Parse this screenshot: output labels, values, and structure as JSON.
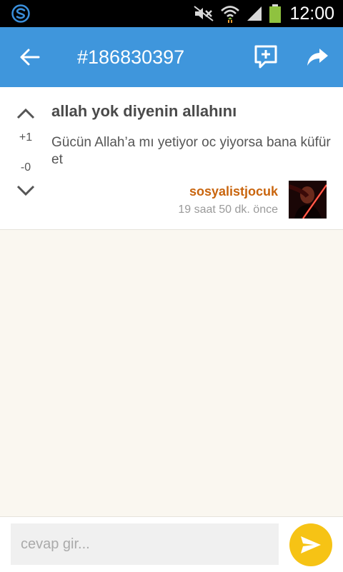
{
  "status_bar": {
    "time": "12:00",
    "icons": [
      "app-logo-icon",
      "mute-icon",
      "wifi-icon",
      "signal-icon",
      "battery-icon"
    ]
  },
  "header": {
    "title": "#186830397",
    "back_icon": "arrow-left-icon",
    "add_comment_icon": "add-comment-icon",
    "share_icon": "share-icon",
    "color": "#3f96dc"
  },
  "entry": {
    "topic": "allah yok diyenin allahını",
    "body": "Gücün Allah’a mı yetiyor oc yiyorsa bana küfür et",
    "upvotes": "+1",
    "downvotes": "-0",
    "author": "sosyalistjocuk",
    "time": "19 saat 50 dk. önce"
  },
  "composer": {
    "placeholder": "cevap gir...",
    "value": "",
    "send_icon": "send-icon",
    "send_color": "#f6c315"
  }
}
